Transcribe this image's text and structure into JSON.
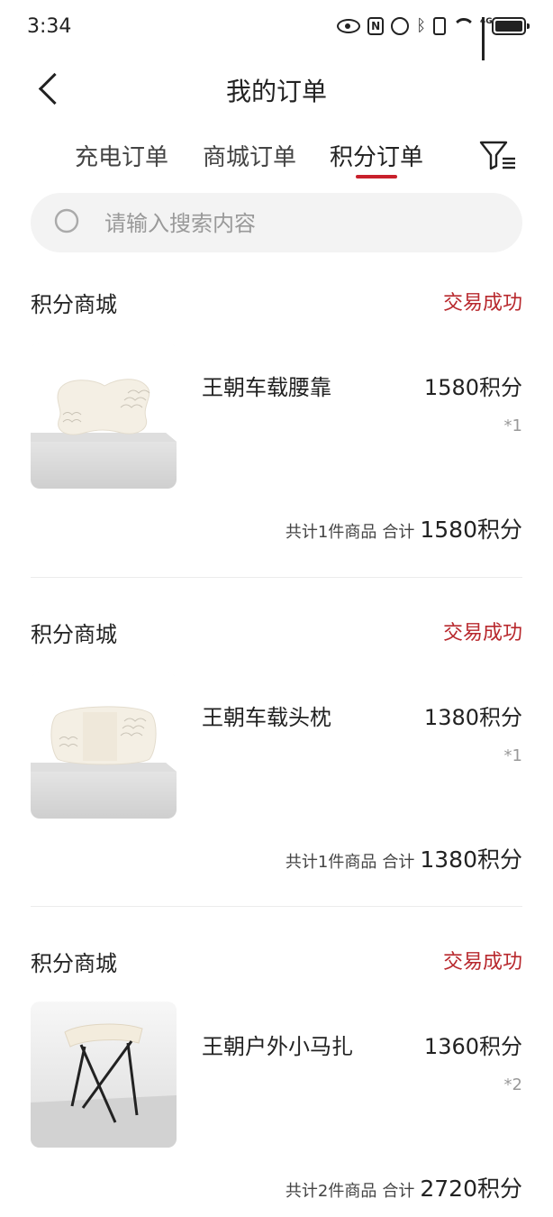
{
  "status_bar": {
    "time": "3:34",
    "network": "4G"
  },
  "header": {
    "title": "我的订单"
  },
  "tabs": [
    {
      "label": "充电订单",
      "active": false
    },
    {
      "label": "商城订单",
      "active": false
    },
    {
      "label": "积分订单",
      "active": true
    }
  ],
  "search": {
    "placeholder": "请输入搜索内容",
    "value": ""
  },
  "colors": {
    "accent": "#c8202b",
    "status_text": "#b8282d",
    "search_bg": "#f3f3f3"
  },
  "orders": [
    {
      "store": "积分商城",
      "status": "交易成功",
      "product_name": "王朝车载腰靠",
      "price": "1580积分",
      "quantity": "*1",
      "item_count_text": "共计1件商品",
      "total_label": "合计",
      "total": "1580积分",
      "image": "lumbar-pillow"
    },
    {
      "store": "积分商城",
      "status": "交易成功",
      "product_name": "王朝车载头枕",
      "price": "1380积分",
      "quantity": "*1",
      "item_count_text": "共计1件商品",
      "total_label": "合计",
      "total": "1380积分",
      "image": "headrest-pillow"
    },
    {
      "store": "积分商城",
      "status": "交易成功",
      "product_name": "王朝户外小马扎",
      "price": "1360积分",
      "quantity": "*2",
      "item_count_text": "共计2件商品",
      "total_label": "合计",
      "total": "2720积分",
      "image": "folding-stool"
    }
  ]
}
